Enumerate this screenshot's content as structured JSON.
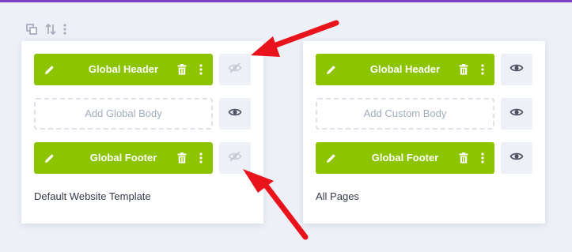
{
  "colors": {
    "accent_purple": "#7b3fc6",
    "bar_green": "#8dc400",
    "page_background": "#eef0f7",
    "arrow_red": "#e8131b"
  },
  "toolbar": {
    "icons": [
      "duplicate-icon",
      "sort-icon",
      "more-options-icon"
    ]
  },
  "templates": [
    {
      "title": "Default Website Template",
      "header": {
        "label": "Global Header",
        "visibility": "hidden"
      },
      "body": {
        "label": "Add Global Body",
        "visibility": "visible"
      },
      "footer": {
        "label": "Global Footer",
        "visibility": "hidden"
      }
    },
    {
      "title": "All Pages",
      "header": {
        "label": "Global Header",
        "visibility": "visible"
      },
      "body": {
        "label": "Add Custom Body",
        "visibility": "visible"
      },
      "footer": {
        "label": "Global Footer",
        "visibility": "visible"
      }
    }
  ]
}
